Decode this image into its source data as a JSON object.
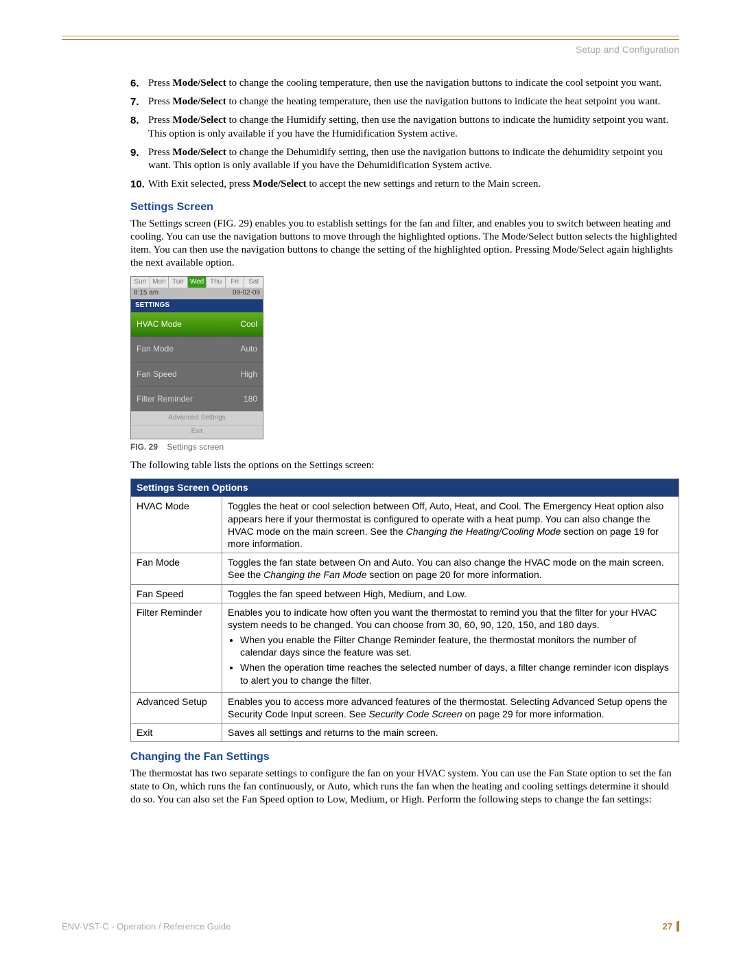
{
  "header": {
    "section": "Setup and Configuration"
  },
  "steps": [
    {
      "n": "6.",
      "pre": "Press ",
      "bold": "Mode/Select",
      "rest": " to change the cooling temperature, then use the navigation buttons to indicate the cool setpoint you want."
    },
    {
      "n": "7.",
      "pre": "Press ",
      "bold": "Mode/Select",
      "rest": " to change the heating temperature, then use the navigation buttons to indicate the heat setpoint you want."
    },
    {
      "n": "8.",
      "pre": "Press ",
      "bold": "Mode/Select",
      "rest": " to change the Humidify setting, then use the navigation buttons to indicate the humidity setpoint you want. This option is only available if you have the Humidification System active."
    },
    {
      "n": "9.",
      "pre": "Press ",
      "bold": "Mode/Select",
      "rest": " to change the Dehumidify setting, then use the navigation buttons to indicate the dehumidity setpoint you want. This option is only available if you have the Dehumidification System active."
    },
    {
      "n": "10.",
      "pre": "With Exit selected, press ",
      "bold": "Mode/Select",
      "rest": " to accept the new settings and return to the Main screen."
    }
  ],
  "settings_heading": "Settings Screen",
  "settings_para": "The Settings screen (FIG. 29) enables you to establish settings for the fan and filter, and enables you to switch between heating and cooling. You can use the navigation buttons to move through the highlighted options. The Mode/Select button selects the highlighted item. You can then use the navigation buttons to change the setting of the highlighted option. Pressing Mode/Select again highlights the next available option.",
  "device": {
    "days": [
      "Sun",
      "Mon",
      "Tue",
      "Wed",
      "Thu",
      "Fri",
      "Sat"
    ],
    "active_day_index": 3,
    "time": "8:15 am",
    "date": "09-02-09",
    "title": "SETTINGS",
    "rows": [
      {
        "label": "HVAC Mode",
        "value": "Cool",
        "hvac": true
      },
      {
        "label": "Fan Mode",
        "value": "Auto",
        "hvac": false
      },
      {
        "label": "Fan Speed",
        "value": "High",
        "hvac": false
      },
      {
        "label": "Filter Reminder",
        "value": "180",
        "hvac": false
      }
    ],
    "footer1": "Advanced Settings",
    "footer2": "Exit"
  },
  "fig": {
    "label": "FIG. 29",
    "caption": "Settings screen"
  },
  "pre_table": "The following table lists the options on the Settings screen:",
  "table": {
    "header": "Settings Screen Options",
    "rows": [
      {
        "name": "HVAC Mode",
        "desc_pre": "Toggles the heat or cool selection between Off, Auto, Heat, and Cool. The Emergency Heat option also appears here if your thermostat is configured to operate with a heat pump. You can also change the HVAC mode on the main screen. See the ",
        "desc_em": "Changing the Heating/Cooling Mode",
        "desc_post": " section on page 19 for more information.",
        "bullets": []
      },
      {
        "name": "Fan Mode",
        "desc_pre": "Toggles the fan state between On and Auto. You can also change the HVAC mode on the main screen. See the ",
        "desc_em": "Changing the Fan Mode",
        "desc_post": " section on page 20 for more information.",
        "bullets": []
      },
      {
        "name": "Fan Speed",
        "desc_pre": "Toggles the fan speed between High, Medium, and Low.",
        "desc_em": "",
        "desc_post": "",
        "bullets": []
      },
      {
        "name": "Filter Reminder",
        "desc_pre": "Enables you to indicate how often you want the thermostat to remind you that the filter for your HVAC system needs to be changed. You can choose from 30, 60, 90, 120, 150, and 180 days.",
        "desc_em": "",
        "desc_post": "",
        "bullets": [
          "When you enable the Filter Change Reminder feature, the thermostat monitors the number of calendar days since the feature was set.",
          "When the operation time reaches the selected number of days, a filter change reminder icon displays to alert you to change the filter."
        ]
      },
      {
        "name": "Advanced Setup",
        "desc_pre": "Enables you to access more advanced features of the thermostat. Selecting Advanced Setup opens the Security Code Input screen. See ",
        "desc_em": "Security Code Screen",
        "desc_post": "  on page 29 for more information.",
        "bullets": []
      },
      {
        "name": "Exit",
        "desc_pre": "Saves all settings and returns to the main screen.",
        "desc_em": "",
        "desc_post": "",
        "bullets": []
      }
    ]
  },
  "fan_heading": "Changing the Fan Settings",
  "fan_para": "The thermostat has two separate settings to configure the fan on your HVAC system. You can use the Fan State option to set the fan state to On, which runs the fan continuously, or Auto, which runs the fan when the heating and cooling settings determine it should do so. You can also set the Fan Speed option to Low, Medium, or High. Perform the following steps to change the fan settings:",
  "footer": {
    "left": "ENV-VST-C - Operation / Reference Guide",
    "page": "27"
  }
}
